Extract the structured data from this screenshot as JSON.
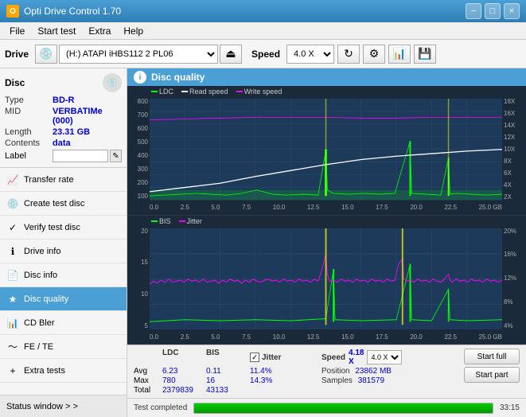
{
  "app": {
    "title": "Opti Drive Control 1.70",
    "icon": "O"
  },
  "title_buttons": {
    "minimize": "−",
    "maximize": "□",
    "close": "×"
  },
  "menu": {
    "items": [
      "File",
      "Start test",
      "Extra",
      "Help"
    ]
  },
  "toolbar": {
    "drive_label": "Drive",
    "drive_value": "(H:) ATAPI iHBS112  2 PL06",
    "speed_label": "Speed",
    "speed_value": "4.0 X"
  },
  "disc": {
    "title": "Disc",
    "type_label": "Type",
    "type_value": "BD-R",
    "mid_label": "MID",
    "mid_value": "VERBATIMe (000)",
    "length_label": "Length",
    "length_value": "23.31 GB",
    "contents_label": "Contents",
    "contents_value": "data",
    "label_label": "Label"
  },
  "nav_items": [
    {
      "id": "transfer-rate",
      "label": "Transfer rate",
      "icon": "📈"
    },
    {
      "id": "create-test-disc",
      "label": "Create test disc",
      "icon": "💿"
    },
    {
      "id": "verify-test-disc",
      "label": "Verify test disc",
      "icon": "✓"
    },
    {
      "id": "drive-info",
      "label": "Drive info",
      "icon": "ℹ"
    },
    {
      "id": "disc-info",
      "label": "Disc info",
      "icon": "📄"
    },
    {
      "id": "disc-quality",
      "label": "Disc quality",
      "icon": "★",
      "active": true
    },
    {
      "id": "cd-bler",
      "label": "CD Bler",
      "icon": "📊"
    },
    {
      "id": "fe-te",
      "label": "FE / TE",
      "icon": "〜"
    },
    {
      "id": "extra-tests",
      "label": "Extra tests",
      "icon": "+"
    }
  ],
  "status_window": {
    "label": "Status window > >"
  },
  "disc_quality": {
    "title": "Disc quality",
    "icon": "i"
  },
  "chart1": {
    "legend": [
      {
        "label": "LDC",
        "color": "#00ff00"
      },
      {
        "label": "Read speed",
        "color": "#ffffff"
      },
      {
        "label": "Write speed",
        "color": "#ff00ff"
      }
    ],
    "y_labels_left": [
      "800",
      "700",
      "600",
      "500",
      "400",
      "300",
      "200",
      "100"
    ],
    "y_labels_right": [
      "18X",
      "16X",
      "14X",
      "12X",
      "10X",
      "8X",
      "6X",
      "4X",
      "2X"
    ],
    "x_labels": [
      "0.0",
      "2.5",
      "5.0",
      "7.5",
      "10.0",
      "12.5",
      "15.0",
      "17.5",
      "20.0",
      "22.5",
      "25.0 GB"
    ]
  },
  "chart2": {
    "legend": [
      {
        "label": "BIS",
        "color": "#00ff00"
      },
      {
        "label": "Jitter",
        "color": "#ff00ff"
      }
    ],
    "y_labels_left": [
      "20",
      "15",
      "10",
      "5"
    ],
    "y_labels_right": [
      "20%",
      "16%",
      "12%",
      "8%",
      "4%"
    ],
    "x_labels": [
      "0.0",
      "2.5",
      "5.0",
      "7.5",
      "10.0",
      "12.5",
      "15.0",
      "17.5",
      "20.0",
      "22.5",
      "25.0 GB"
    ]
  },
  "stats": {
    "headers": [
      "LDC",
      "BIS",
      "",
      "Jitter",
      "Speed",
      ""
    ],
    "avg_label": "Avg",
    "max_label": "Max",
    "total_label": "Total",
    "ldc_avg": "6.23",
    "ldc_max": "780",
    "ldc_total": "2379839",
    "bis_avg": "0.11",
    "bis_max": "16",
    "bis_total": "43133",
    "jitter_avg": "11.4%",
    "jitter_max": "14.3%",
    "jitter_checked": true,
    "speed_label": "Speed",
    "speed_val": "4.18 X",
    "speed_select": "4.0 X",
    "position_label": "Position",
    "position_val": "23862 MB",
    "samples_label": "Samples",
    "samples_val": "381579",
    "btn_start_full": "Start full",
    "btn_start_part": "Start part"
  },
  "progress": {
    "status_text": "Test completed",
    "progress_percent": 100,
    "time_text": "33:15"
  }
}
